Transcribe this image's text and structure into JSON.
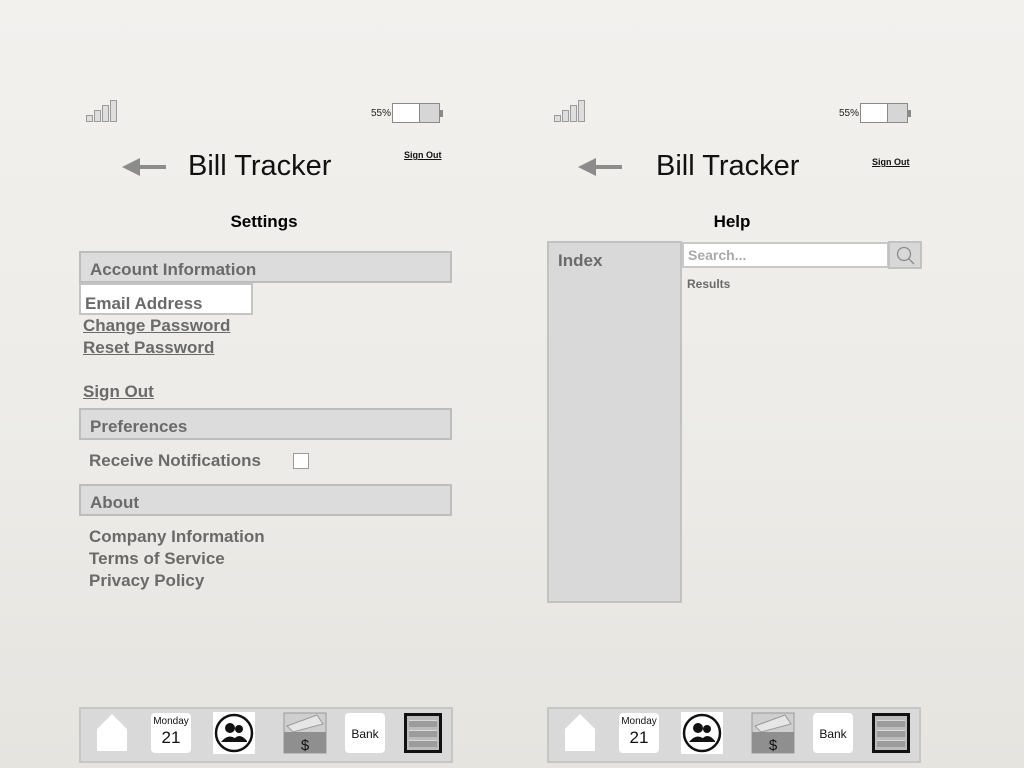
{
  "status": {
    "battery_percent": "55%",
    "battery_level": 0.55
  },
  "header": {
    "app_title": "Bill Tracker",
    "sign_out": "Sign Out"
  },
  "settings": {
    "title": "Settings",
    "account_header": "Account Information",
    "email_address": "Email Address",
    "change_password": "Change Password",
    "reset_password": "Reset Password",
    "sign_out": "Sign Out",
    "preferences_header": "Preferences",
    "receive_notifications": "Receive Notifications",
    "notifications_checked": false,
    "about_header": "About",
    "company_information": "Company Information",
    "terms_of_service": "Terms of Service",
    "privacy_policy": "Privacy Policy"
  },
  "help": {
    "title": "Help",
    "index_label": "Index",
    "search_placeholder": "Search...",
    "results_label": "Results"
  },
  "tabbar": {
    "calendar_day": "Monday",
    "calendar_date": "21",
    "bills_symbol": "$",
    "bank_label": "Bank"
  }
}
